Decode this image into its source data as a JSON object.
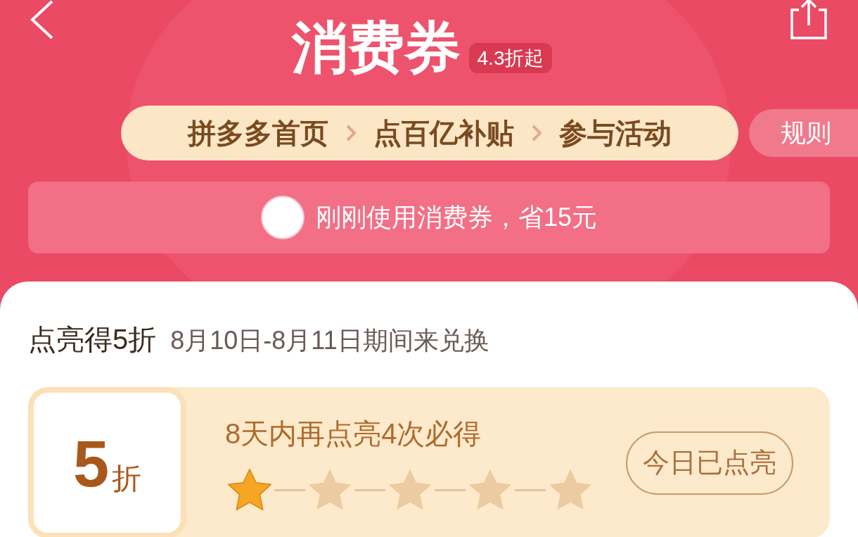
{
  "header": {
    "title": "消费券",
    "badge": "4.3折起"
  },
  "steps": [
    {
      "label": "拼多多首页"
    },
    {
      "label": "点百亿补贴"
    },
    {
      "label": "参与活动"
    }
  ],
  "rules_button": "规则",
  "notice": {
    "text": "刚刚使用消费券，省15元"
  },
  "section": {
    "title": "点亮得5折",
    "subtitle": "8月10日-8月11日期间来兑换"
  },
  "tier": {
    "discount": "5",
    "unit": "折",
    "progress_text": "8天内再点亮4次必得",
    "button": "今日已点亮",
    "star_slots": [
      {
        "lit": true
      },
      {
        "lit": false
      },
      {
        "lit": false
      },
      {
        "lit": false
      },
      {
        "lit": false
      }
    ]
  }
}
